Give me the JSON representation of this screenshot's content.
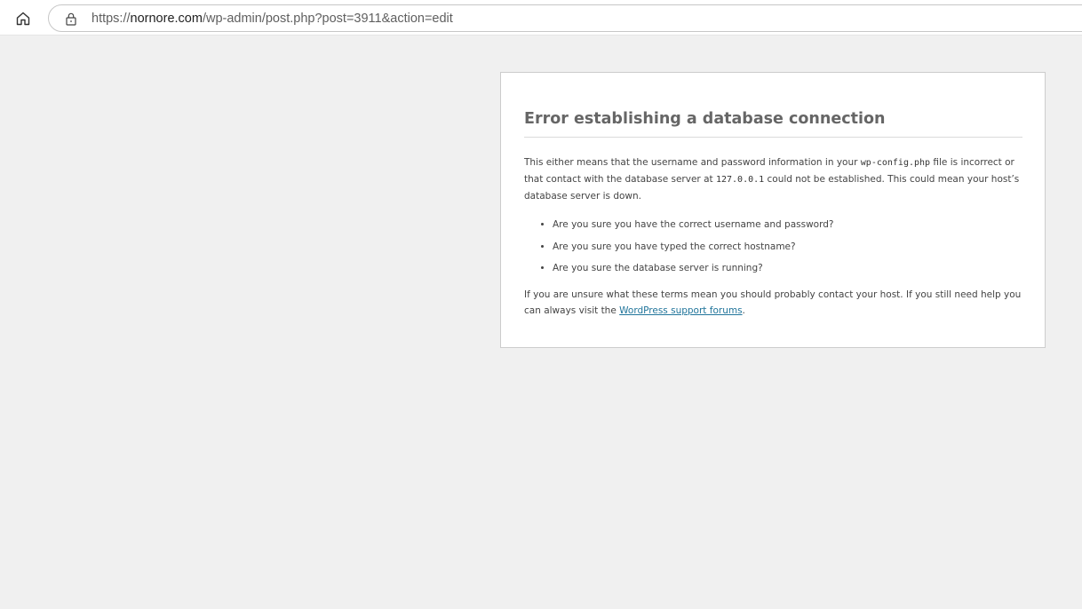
{
  "browser": {
    "home_icon": "home-icon",
    "lock_icon": "lock-icon",
    "url_scheme": "https://",
    "url_domain": "nornore.com",
    "url_path": "/wp-admin/post.php?post=3911&action=edit"
  },
  "error": {
    "title": "Error establishing a database connection",
    "intro_part1": "This either means that the username and password information in your ",
    "config_file": "wp-config.php",
    "intro_part2": " file is incorrect or that contact with the database server at ",
    "server_address": "127.0.0.1",
    "intro_part3": " could not be established. This could mean your host’s database server is down.",
    "checklist": [
      "Are you sure you have the correct username and password?",
      "Are you sure you have typed the correct hostname?",
      "Are you sure the database server is running?"
    ],
    "footer_part1": "If you are unsure what these terms mean you should probably contact your host. If you still need help you can always visit the ",
    "support_link_label": "WordPress support forums",
    "footer_part2": "."
  }
}
